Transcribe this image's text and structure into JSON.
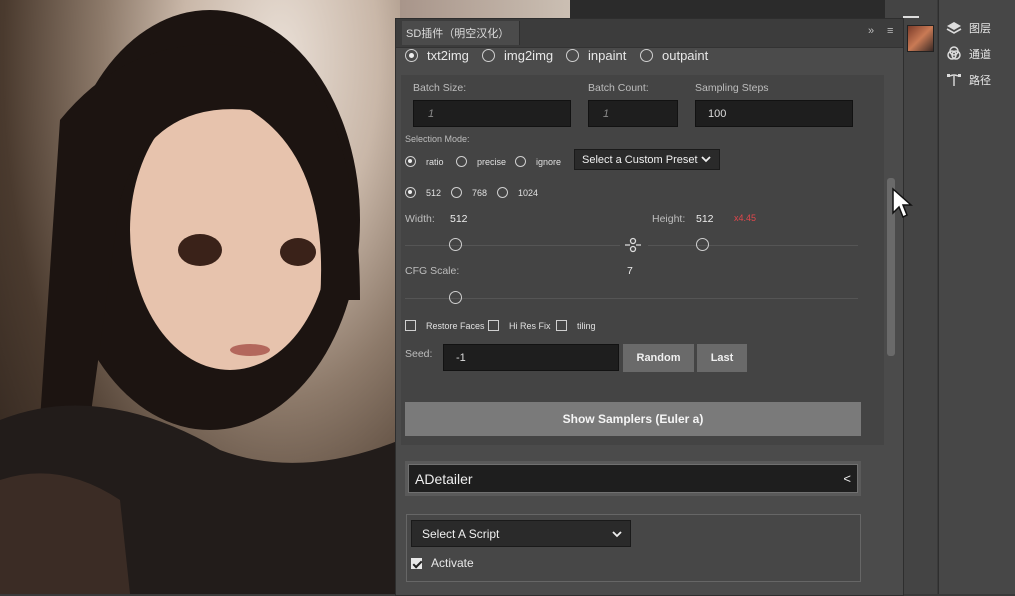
{
  "panel": {
    "title": "SD插件（明空汉化）",
    "collapse_icon": "»",
    "menu_icon": "≡"
  },
  "modes": [
    {
      "label": "txt2img",
      "selected": true
    },
    {
      "label": "img2img",
      "selected": false
    },
    {
      "label": "inpaint",
      "selected": false
    },
    {
      "label": "outpaint",
      "selected": false
    }
  ],
  "batch_size": {
    "label": "Batch Size:",
    "placeholder": "1"
  },
  "batch_count": {
    "label": "Batch Count:",
    "placeholder": "1"
  },
  "sampling_steps": {
    "label": "Sampling Steps",
    "value": "100"
  },
  "selection_mode": {
    "label": "Selection Mode:",
    "options": [
      {
        "label": "ratio",
        "selected": true
      },
      {
        "label": "precise",
        "selected": false
      },
      {
        "label": "ignore",
        "selected": false
      }
    ],
    "preset": "Select a Custom Preset"
  },
  "sizes": [
    {
      "label": "512",
      "selected": true
    },
    {
      "label": "768",
      "selected": false
    },
    {
      "label": "1024",
      "selected": false
    }
  ],
  "width": {
    "label": "Width:",
    "value": "512"
  },
  "height": {
    "label": "Height:",
    "value": "512",
    "ratio": "x4.45"
  },
  "cfg": {
    "label": "CFG Scale:",
    "value": "7"
  },
  "options": [
    {
      "label": "Restore Faces",
      "checked": false
    },
    {
      "label": "Hi Res Fix",
      "checked": false
    },
    {
      "label": "tiling",
      "checked": false
    }
  ],
  "seed": {
    "label": "Seed:",
    "value": "-1",
    "random_label": "Random",
    "last_label": "Last"
  },
  "samplers_button": "Show Samplers (Euler a)",
  "adetailer": {
    "label": "ADetailer",
    "toggle": "<"
  },
  "script": {
    "select": "Select A Script",
    "activate_label": "Activate",
    "activate_checked": true
  },
  "layers_panel": {
    "items": [
      "图层",
      "通道",
      "路径"
    ]
  },
  "colors": {
    "accent_ratio": "#e0474c"
  }
}
